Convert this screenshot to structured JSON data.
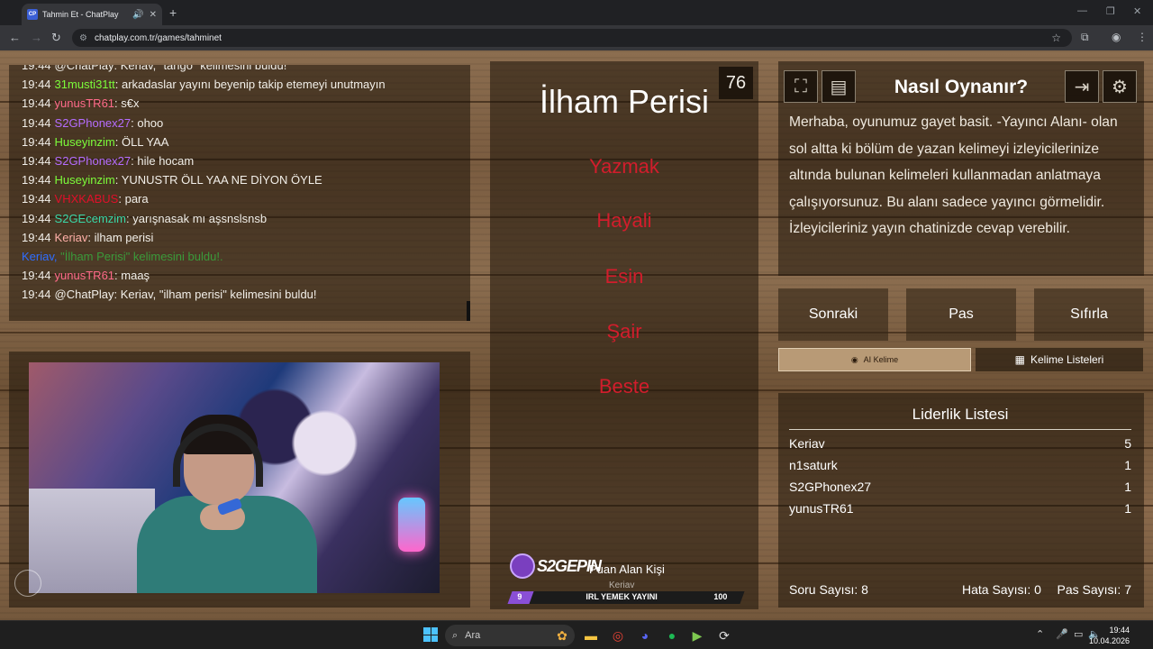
{
  "browser": {
    "tab_title": "Tahmin Et - ChatPlay",
    "tab_favicon": "CP",
    "url": "chatplay.com.tr/games/tahminet"
  },
  "chat": {
    "messages": [
      {
        "time": "19:44",
        "user": "@ChatPlay",
        "user_color": "#f2efe9",
        "text": ": Keriav, \"tango\" kelimesini buldu!"
      },
      {
        "time": "19:44",
        "user": "31musti31tt",
        "user_color": "#7cfc3a",
        "text": ": arkadaslar yayını beyenip takip etemeyi unutmayın"
      },
      {
        "time": "19:44",
        "user": "yunusTR61",
        "user_color": "#ff6a8a",
        "text": ": s€x"
      },
      {
        "time": "19:44",
        "user": "S2GPhonex27",
        "user_color": "#b56cff",
        "text": ": ohoo"
      },
      {
        "time": "19:44",
        "user": "Huseyinzim",
        "user_color": "#7cfc3a",
        "text": ": ÖLL YAA"
      },
      {
        "time": "19:44",
        "user": "S2GPhonex27",
        "user_color": "#b56cff",
        "text": ": hile hocam"
      },
      {
        "time": "19:44",
        "user": "Huseyinzim",
        "user_color": "#7cfc3a",
        "text": ": YUNUSTR ÖLL YAA NE DİYON ÖYLE"
      },
      {
        "time": "19:44",
        "user": "VHXKABUS",
        "user_color": "#e0102a",
        "text": ": para"
      },
      {
        "time": "19:44",
        "user": "S2GEcemzim",
        "user_color": "#3ad8a8",
        "text": ": yarışnasak mı aşsnslsnsb"
      },
      {
        "time": "19:44",
        "user": "Keriav",
        "user_color": "#ffb0a8",
        "text": ": ilham perisi"
      },
      {
        "time": "",
        "user": "Keriav, ",
        "user_color": "#2f6dff",
        "text": "\"İlham Perisi\" kelimesini buldu!."
      },
      {
        "time": "19:44",
        "user": "yunusTR61",
        "user_color": "#ff6a8a",
        "text": ": maaş"
      },
      {
        "time": "19:44",
        "user": "@ChatPlay",
        "user_color": "#f2efe9",
        "text": ": Keriav, \"ilham perisi\" kelimesini buldu!"
      }
    ]
  },
  "game": {
    "counter": "76",
    "word": "İlham Perisi",
    "forbidden": [
      "Yazmak",
      "Hayali",
      "Esin",
      "Şair",
      "Beste"
    ],
    "brand": "S2GEPIN",
    "scorer_label": "Puan Alan Kişi",
    "scorer_name": "Keriav",
    "bar_level": "9",
    "bar_title": "IRL YEMEK YAYINI",
    "bar_value": "100"
  },
  "howto": {
    "title": "Nasıl Oynanır?",
    "text": "Merhaba, oyunumuz gayet basit. -Yayıncı Alanı- olan sol altta ki bölüm de yazan kelimeyi izleyicilerinize altında bulunan kelimeleri kullanmadan anlatmaya çalışıyorsunuz. Bu alanı sadece yayıncı görmelidir. İzleyicileriniz yayın chatinizde cevap verebilir."
  },
  "controls": {
    "next": "Sonraki",
    "pass": "Pas",
    "reset": "Sıfırla",
    "ai_word": "AI Kelime",
    "word_lists": "Kelime Listeleri"
  },
  "leaderboard": {
    "title": "Liderlik Listesi",
    "rows": [
      {
        "name": "Keriav",
        "score": "5"
      },
      {
        "name": "n1saturk",
        "score": "1"
      },
      {
        "name": "S2GPhonex27",
        "score": "1"
      },
      {
        "name": "yunusTR61",
        "score": "1"
      }
    ],
    "question_count": "Soru Sayısı: 8",
    "error_count": "Hata Sayısı: 0",
    "pass_count": "Pas Sayısı: 7"
  },
  "taskbar": {
    "search_placeholder": "Ara",
    "time": "19:44",
    "date": "10.04.2026"
  },
  "colors": {
    "forbidden": "#d21d2c",
    "panel": "rgba(30,20,10,0.55)",
    "accent": "#8a4fd6"
  }
}
